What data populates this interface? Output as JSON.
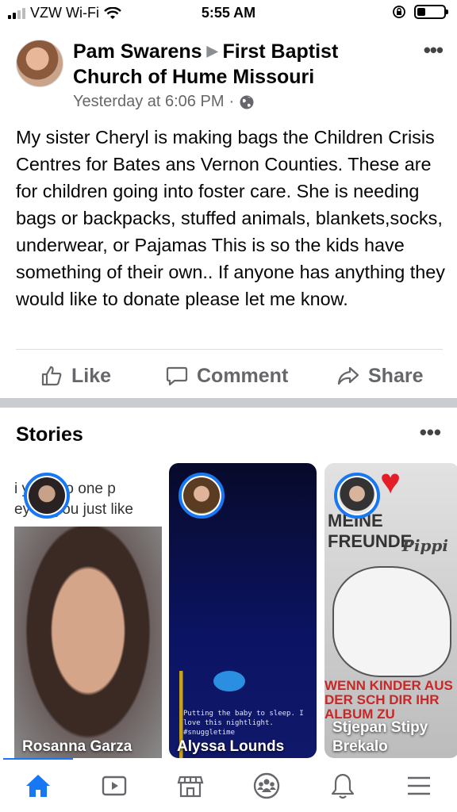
{
  "status_bar": {
    "carrier": "VZW Wi-Fi",
    "time": "5:55 AM",
    "signal_bars": 2,
    "battery_level": 0.3
  },
  "post": {
    "author": "Pam Swarens",
    "group": "First Baptist Church of Hume Missouri",
    "timestamp": "Yesterday at 6:06 PM",
    "audience_icon": "globe-icon",
    "text": "My sister Cheryl is making bags the Children Crisis Centres for Bates ans Vernon Counties. These are for children going into foster care. She is needing bags or backpacks, stuffed animals, blankets,socks, underwear, or Pajamas This is so the kids have something of their own.. If anyone has anything they would like to donate please let me know.",
    "actions": {
      "like": "Like",
      "comment": "Comment",
      "share": "Share"
    }
  },
  "stories": {
    "title": "Stories",
    "items": [
      {
        "name": "Rosanna Garza",
        "caption_line1": "i     y talk to one p",
        "caption_line2": "ey          so you just like"
      },
      {
        "name": "Alyssa Lounds",
        "note": "Putting the baby to sleep. I love this nightlight. #snuggletime"
      },
      {
        "name": "Stjepan Stipy Brekalo",
        "book_title": "MEINE FREUNDE",
        "book_sub": "Pippi",
        "book_red": "WENN KINDER AUS DER SCH DIR IHR ALBUM ZU"
      }
    ]
  },
  "tabbar": {
    "active": "home",
    "tabs": [
      "home-icon",
      "watch-icon",
      "marketplace-icon",
      "groups-icon",
      "notifications-icon",
      "menu-icon"
    ]
  },
  "colors": {
    "accent": "#1877f2",
    "secondary_text": "#65676b",
    "separator": "#c9ccd1"
  }
}
